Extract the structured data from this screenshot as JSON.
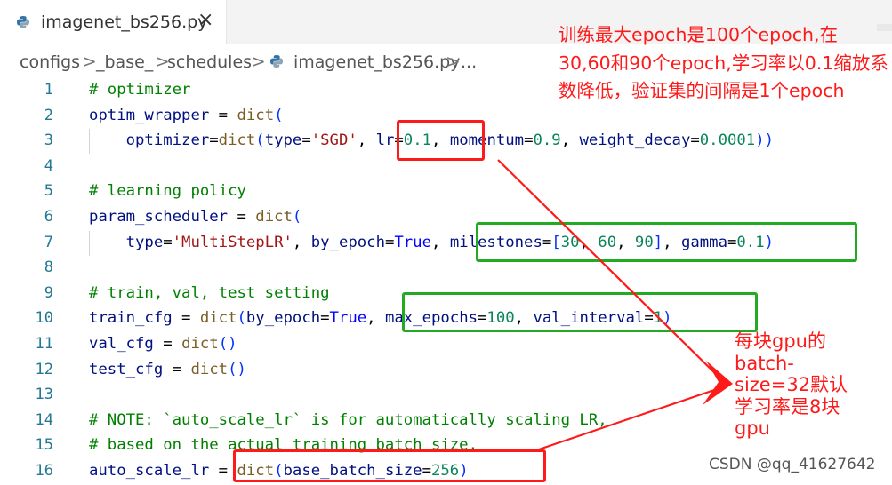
{
  "tab": {
    "title": "imagenet_bs256.py",
    "close_glyph": "×",
    "icon": "python-file-icon"
  },
  "breadcrumb": {
    "items": [
      "configs",
      "_base_",
      "schedules",
      "imagenet_bs256.py",
      "..."
    ],
    "separator": ">"
  },
  "editor": {
    "line_numbers": [
      "1",
      "2",
      "3",
      "4",
      "5",
      "6",
      "7",
      "8",
      "9",
      "10",
      "11",
      "12",
      "13",
      "14",
      "15",
      "16"
    ],
    "lines": [
      "# optimizer",
      "optim_wrapper = dict(",
      "    optimizer=dict(type='SGD', lr=0.1, momentum=0.9, weight_decay=0.0001))",
      "",
      "# learning policy",
      "param_scheduler = dict(",
      "    type='MultiStepLR', by_epoch=True, milestones=[30, 60, 90], gamma=0.1)",
      "",
      "# train, val, test setting",
      "train_cfg = dict(by_epoch=True, max_epochs=100, val_interval=1)",
      "val_cfg = dict()",
      "test_cfg = dict()",
      "",
      "# NOTE: `auto_scale_lr` is for automatically scaling LR,",
      "# based on the actual training batch size.",
      "auto_scale_lr = dict(base_batch_size=256)"
    ]
  },
  "annotations": {
    "note_schedule": "训练最大epoch是100个epoch,在30,60和90个epoch,学习率以0.1缩放系数降低，验证集的间隔是1个epoch",
    "note_batch_lines": [
      "每块gpu的",
      "batch-",
      "size=32默认",
      "学习率是8块",
      "gpu"
    ],
    "color_red": "#ff1a1a",
    "color_green": "#22aa22"
  },
  "watermark": "CSDN @qq_41627642"
}
